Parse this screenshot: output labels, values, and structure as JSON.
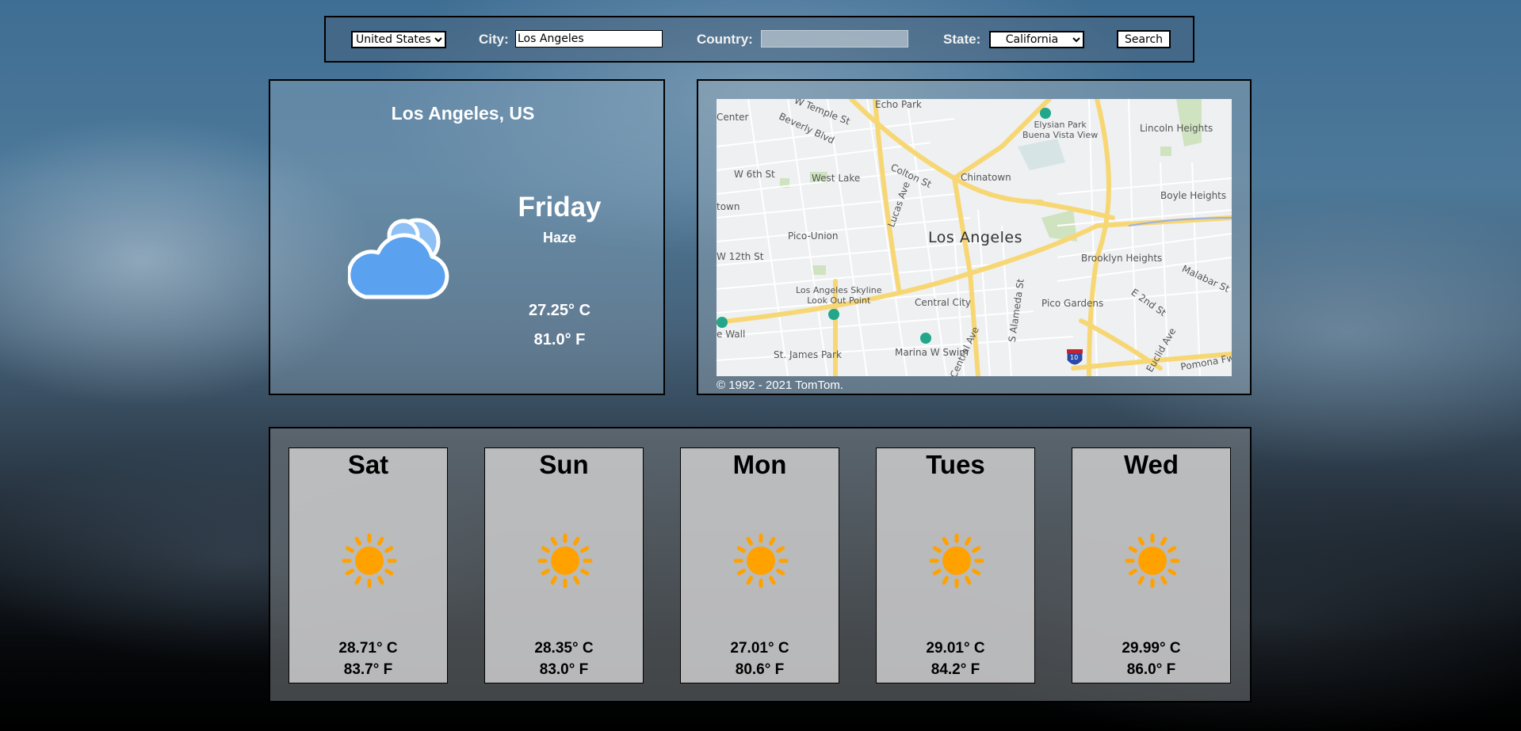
{
  "search": {
    "country_select_value": "United States",
    "city_label": "City:",
    "city_value": "Los Angeles",
    "country_label": "Country:",
    "country_value": "",
    "state_label": "State:",
    "state_select_value": "California",
    "search_button": "Search"
  },
  "today": {
    "location": "Los Angeles, US",
    "day": "Friday",
    "condition": "Haze",
    "temp_c": "27.25° C",
    "temp_f": "81.0° F",
    "icon": "cloud-icon"
  },
  "map": {
    "attribution": "© 1992 - 2021 TomTom.",
    "labels": {
      "echo_park": "Echo Park",
      "center": "Center",
      "w_temple": "W Temple St",
      "beverly": "Beverly Blvd",
      "elysian": "Elysian Park\nBuena Vista View",
      "lincoln": "Lincoln Heights",
      "w6th": "W 6th St",
      "colton": "Colton St",
      "chinatown": "Chinatown",
      "west_lake": "West Lake",
      "town": "town",
      "lucas": "Lucas Ave",
      "boyle": "Boyle Heights",
      "la": "Los Angeles",
      "pico_union": "Pico-Union",
      "w12th": "W 12th St",
      "brooklyn": "Brooklyn Heights",
      "malabar": "Malabar St",
      "skyline": "Los Angeles Skyline\nLook Out Point",
      "central_city": "Central City",
      "s_alameda": "S Alameda St",
      "pico_gardens": "Pico Gardens",
      "e2nd": "E 2nd St",
      "e_wall": "e Wall",
      "marina": "Marina W Swim",
      "s_central": "S Central Ave",
      "euclid": "Euclid Ave",
      "st_james": "St. James Park",
      "pomona": "Pomona Fwy",
      "i10": "10"
    }
  },
  "forecast": [
    {
      "day": "Sat",
      "temp_c": "28.71° C",
      "temp_f": "83.7° F",
      "icon": "sun-icon"
    },
    {
      "day": "Sun",
      "temp_c": "28.35° C",
      "temp_f": "83.0° F",
      "icon": "sun-icon"
    },
    {
      "day": "Mon",
      "temp_c": "27.01° C",
      "temp_f": "80.6° F",
      "icon": "sun-icon"
    },
    {
      "day": "Tues",
      "temp_c": "29.01° C",
      "temp_f": "84.2° F",
      "icon": "sun-icon"
    },
    {
      "day": "Wed",
      "temp_c": "29.99° C",
      "temp_f": "86.0° F",
      "icon": "sun-icon"
    }
  ],
  "colors": {
    "sun": "#ffa200",
    "cloud_front": "#5aa2ef",
    "cloud_back": "#8ec0f5",
    "road_major": "#f7d774",
    "park": "#cfe3c0"
  }
}
